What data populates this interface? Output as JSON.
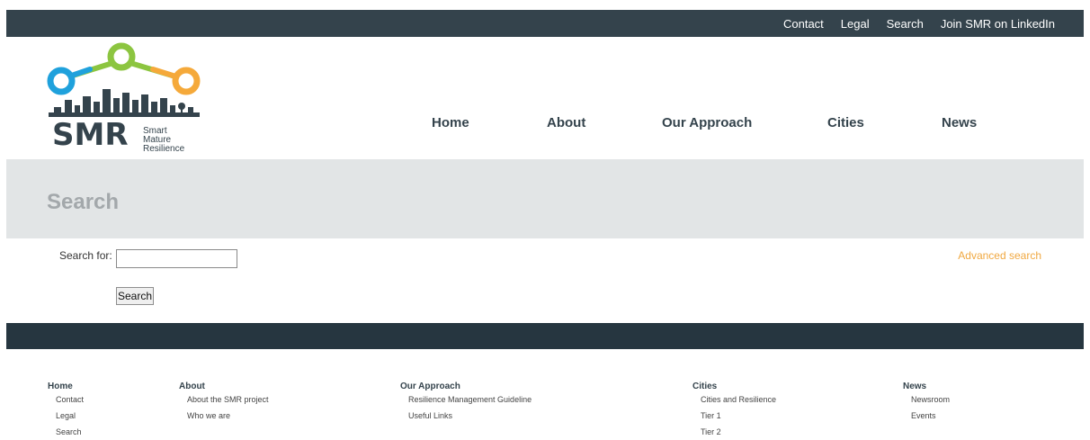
{
  "top_links": [
    "Contact",
    "Legal",
    "Search",
    "Join SMR on LinkedIn"
  ],
  "logo": {
    "text": "SMR",
    "subtitle_lines": [
      "Smart",
      "Mature",
      "Resilience"
    ],
    "colors": {
      "blue": "#1fa1dc",
      "green": "#8cc540",
      "orange": "#f5a93a",
      "dark": "#34434c"
    }
  },
  "main_nav": [
    "Home",
    "About",
    "Our Approach",
    "Cities",
    "News"
  ],
  "page_title": "Search",
  "search": {
    "label": "Search for:",
    "input_value": "",
    "button_label": "Search",
    "advanced_link": "Advanced search"
  },
  "footer": {
    "columns": [
      {
        "heading": "Home",
        "links": [
          "Contact",
          "Legal",
          "Search"
        ]
      },
      {
        "heading": "About",
        "links": [
          "About the SMR project",
          "Who we are"
        ]
      },
      {
        "heading": "Our Approach",
        "links": [
          "Resilience Management Guideline",
          "Useful Links"
        ]
      },
      {
        "heading": "Cities",
        "links": [
          "Cities and Resilience",
          "Tier 1",
          "Tier 2"
        ]
      },
      {
        "heading": "News",
        "links": [
          "Newsroom",
          "Events"
        ]
      }
    ]
  },
  "colors": {
    "topbar": "#34434c",
    "titleband": "#e2e5e6",
    "darkband": "#263640",
    "accent": "#f0a841"
  }
}
